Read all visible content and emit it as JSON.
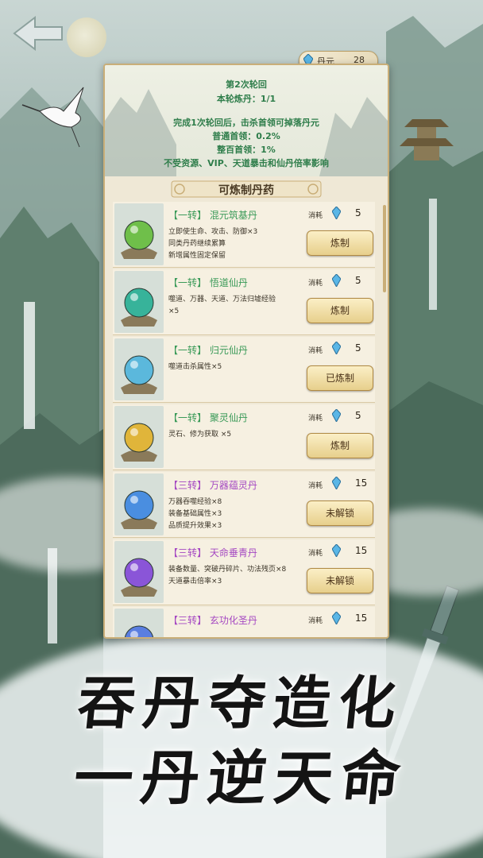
{
  "currency": {
    "icon": "spirit-crystal-icon",
    "name": "丹元",
    "value": "28"
  },
  "info": {
    "round_title": "第2次轮回",
    "progress": "本轮炼丹：1/1",
    "rule": "完成1次轮回后，击杀首领可掉落丹元",
    "normal_boss": "普通首领：0.2%",
    "hundred_boss": "整百首领：1%",
    "note": "不受资源、VIP、天道暴击和仙丹倍率影响"
  },
  "section_title": "可炼制丹药",
  "cost_label": "消耗",
  "pills": [
    {
      "tier": "【一转】",
      "name": "混元筑基丹",
      "tier_class": "t1",
      "desc": "立即使生命、攻击、防御×3\n同类丹药继续累算\n新增属性固定保留",
      "cost": "5",
      "button": "炼制",
      "orb": "#6fbf4a"
    },
    {
      "tier": "【一转】",
      "name": "悟道仙丹",
      "tier_class": "t1",
      "desc": "噬道、万器、天道、万法归墟经验\n×5",
      "cost": "5",
      "button": "炼制",
      "orb": "#37b39a"
    },
    {
      "tier": "【一转】",
      "name": "归元仙丹",
      "tier_class": "t1",
      "desc": "噬道击杀属性×5",
      "cost": "5",
      "button": "已炼制",
      "orb": "#5bb8dc"
    },
    {
      "tier": "【一转】",
      "name": "聚灵仙丹",
      "tier_class": "t1",
      "desc": "灵石、修为获取 ×5",
      "cost": "5",
      "button": "炼制",
      "orb": "#e0b53a"
    },
    {
      "tier": "【三转】",
      "name": "万器蕴灵丹",
      "tier_class": "t3",
      "desc": "万器吞噬经验×8\n装备基础属性×3\n品质提升效果×3",
      "cost": "15",
      "button": "未解锁",
      "orb": "#4a8ee0"
    },
    {
      "tier": "【三转】",
      "name": "天命垂青丹",
      "tier_class": "t3",
      "desc": "装备数量、突破丹碎片、功法残页×8\n天道暴击倍率×3",
      "cost": "15",
      "button": "未解锁",
      "orb": "#8a55d8"
    },
    {
      "tier": "【三转】",
      "name": "玄功化圣丹",
      "tier_class": "t3",
      "desc": "",
      "cost": "15",
      "button": "",
      "orb": "#5a7ee0"
    }
  ],
  "slogan": {
    "line1": "吞丹夺造化",
    "line2": "一丹逆天命"
  },
  "colors": {
    "tier1": "#3a9a58",
    "tier3": "#a548c2",
    "info_text": "#2e7d4a",
    "button_gold": "#e7cf8c"
  }
}
